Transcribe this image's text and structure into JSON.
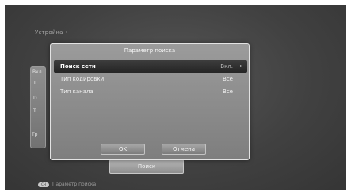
{
  "background": {
    "title": "Устрoйкa •",
    "panel_fragments": [
      "Вкл",
      "Т",
      "D",
      "Т",
      "Тр"
    ],
    "search_button": "Поиск"
  },
  "footer": {
    "key_label": "CH",
    "hint": "Параметр поиска"
  },
  "dialog": {
    "title": "Параметр поиска",
    "rows": [
      {
        "label": "Поиск сети",
        "value": "Вкл."
      },
      {
        "label": "Тип кодировки",
        "value": "Все"
      },
      {
        "label": "Тип канала",
        "value": "Все"
      }
    ],
    "ok_label": "OK",
    "cancel_label": "Отмена"
  }
}
